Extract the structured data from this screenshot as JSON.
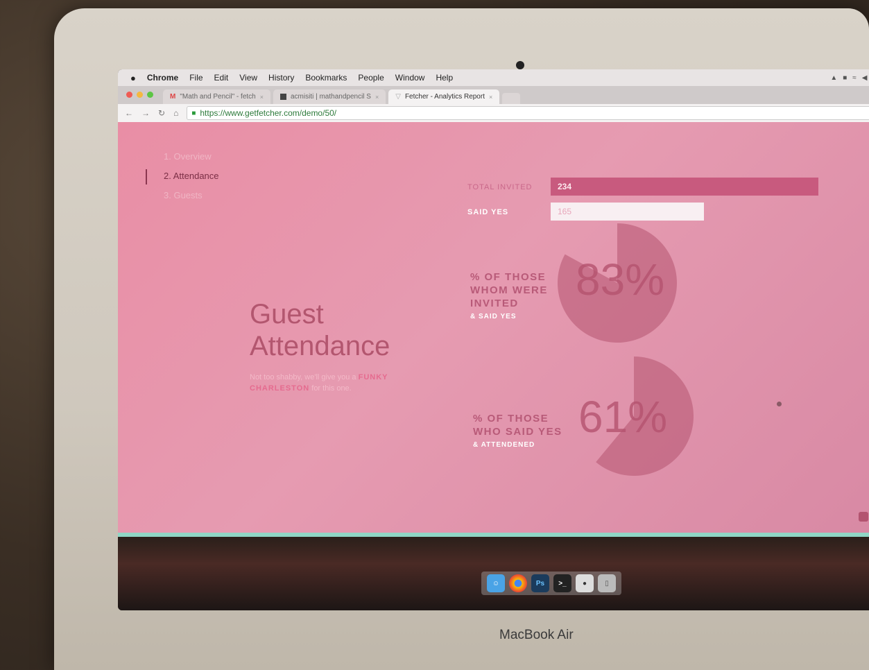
{
  "menubar": {
    "apple_icon": "apple-icon",
    "items": [
      "Chrome",
      "File",
      "Edit",
      "View",
      "History",
      "Bookmarks",
      "People",
      "Window",
      "Help"
    ]
  },
  "tabs": [
    {
      "label": "\"Math and Pencil\" - fetch",
      "icon": "gmail-icon"
    },
    {
      "label": "acmisiti | mathandpencil S",
      "icon": "site-icon"
    },
    {
      "label": "Fetcher - Analytics Report",
      "icon": "fetcher-icon"
    }
  ],
  "address_bar": {
    "url": "https://www.getfetcher.com/demo/50/"
  },
  "sidebar": {
    "items": [
      {
        "label": "1. Overview"
      },
      {
        "label": "2. Attendance"
      },
      {
        "label": "3. Guests"
      }
    ]
  },
  "hero": {
    "title_line1": "Guest",
    "title_line2": "Attendance",
    "tagline_pre": "Not too shabby, we'll give you a ",
    "tagline_bold": "FUNKY CHARLESTON",
    "tagline_post": " for this one."
  },
  "stats": {
    "total_invited_label": "TOTAL INVITED",
    "total_invited_value": "234",
    "said_yes_label": "SAID YES",
    "said_yes_value": "165",
    "said_yes_fraction": 0.56
  },
  "pies": [
    {
      "label_line1": "% OF THOSE",
      "label_line2": "WHOM WERE",
      "label_line3": "INVITED",
      "label_sub": "& SAID YES",
      "value": 83,
      "text": "83%"
    },
    {
      "label_line1": "% OF THOSE",
      "label_line2": "WHO SAID YES",
      "label_sub": "& ATTENDENED",
      "value": 61,
      "text": "61%"
    }
  ],
  "dock": {
    "icons": [
      "finder-icon",
      "chrome-icon",
      "photoshop-icon",
      "terminal-icon",
      "preview-icon",
      "trash-icon"
    ]
  },
  "laptop_brand": "MacBook Air",
  "colors": {
    "page_bg": "#e69bb1",
    "accent": "#b5536f",
    "bar_dark": "#c85a7e",
    "bar_light": "#f8eff2"
  }
}
